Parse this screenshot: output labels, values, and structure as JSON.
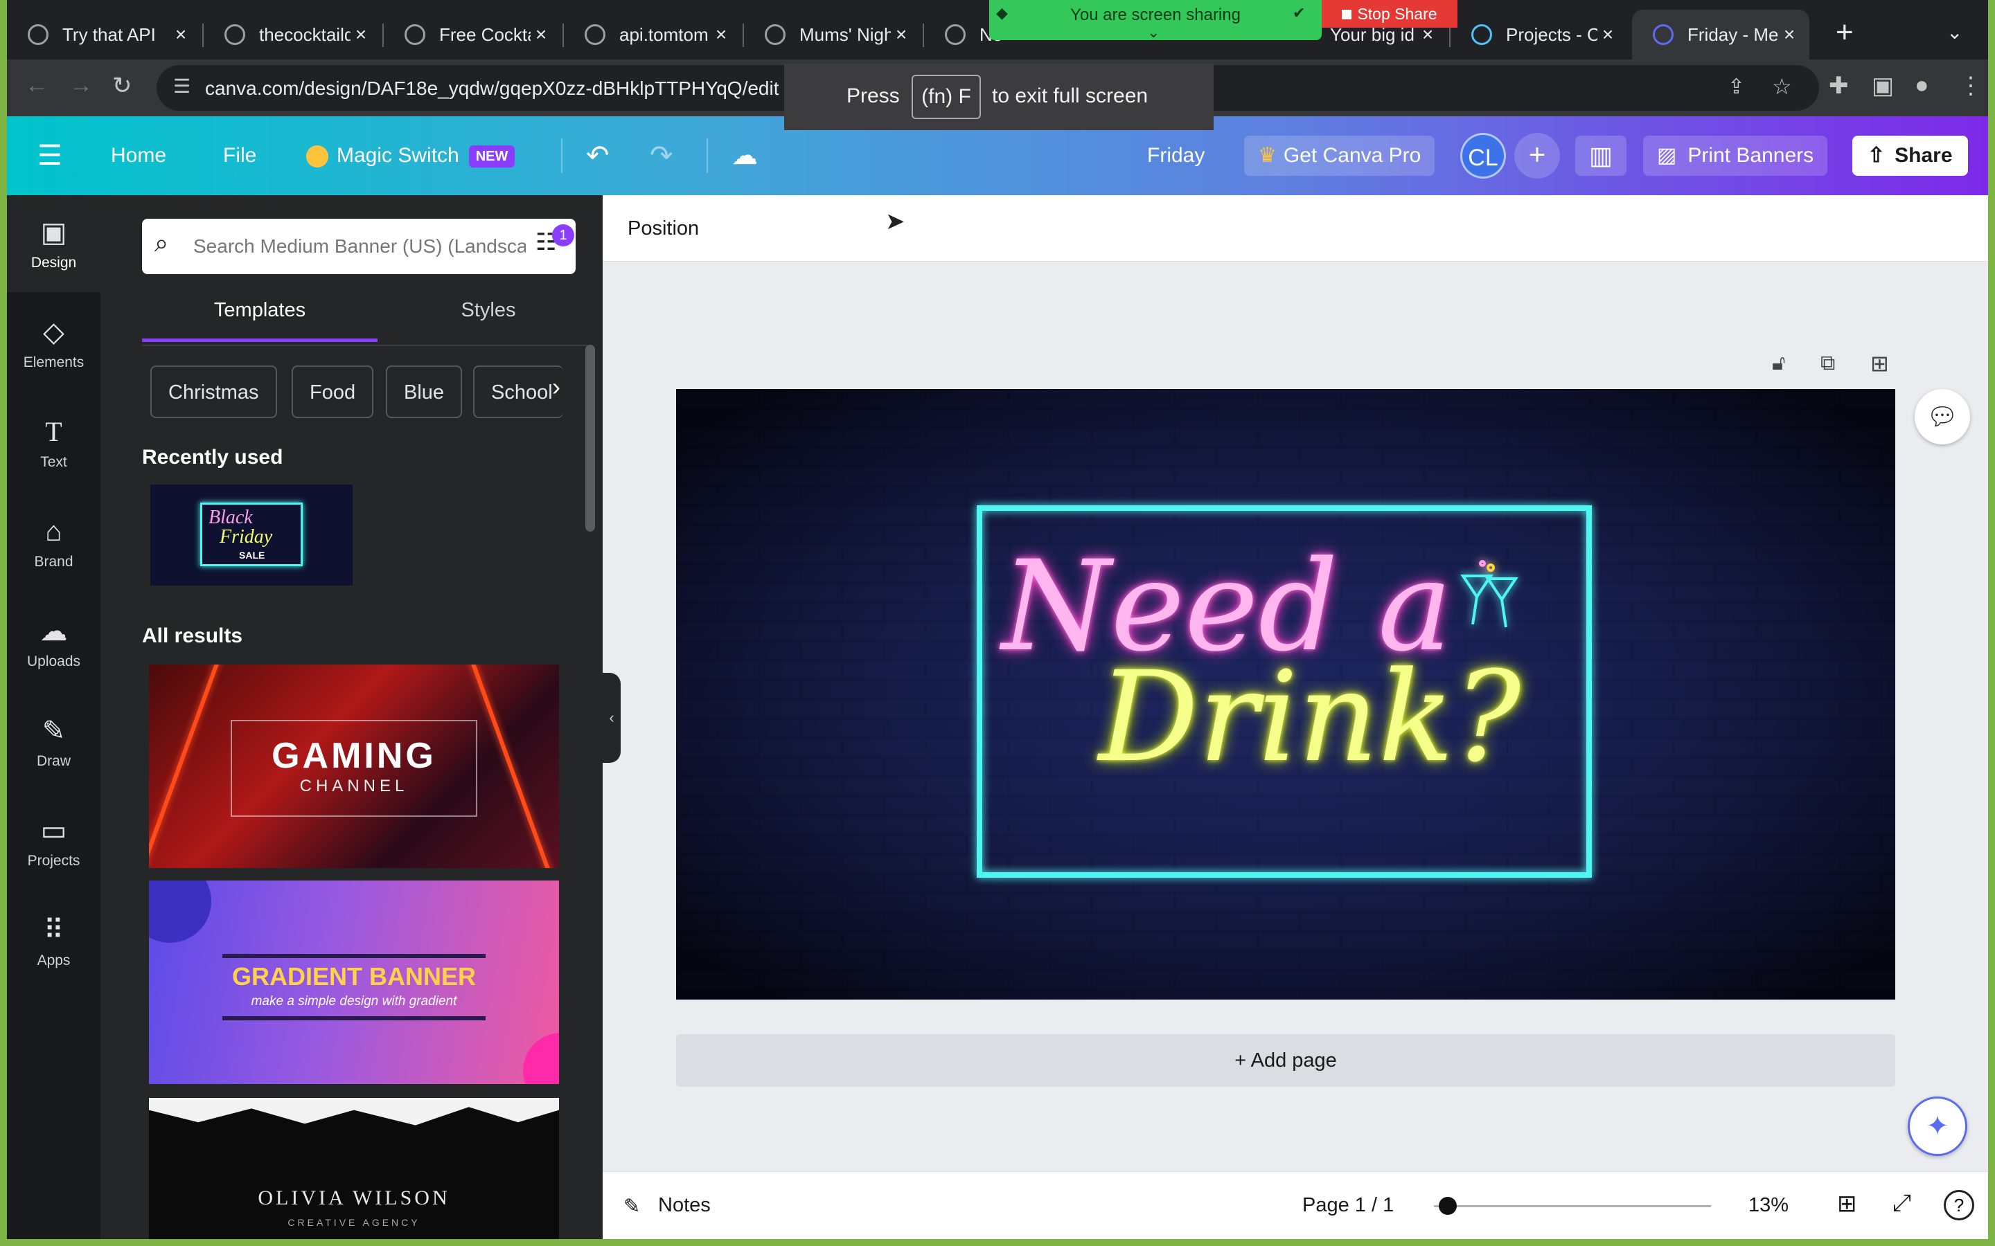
{
  "browser": {
    "tabs": [
      {
        "title": "Try that API"
      },
      {
        "title": "thecocktaildb"
      },
      {
        "title": "Free Cocktail"
      },
      {
        "title": "api.tomtom"
      },
      {
        "title": "Mums' Night"
      },
      {
        "title": "Ne"
      },
      {
        "title": "Your big id"
      },
      {
        "title": "Projects - C"
      },
      {
        "title": "Friday - Me"
      }
    ],
    "url": "canva.com/design/DAF18e_yqdw/gqepX0zz-dBHklpTTPHYqQ/edit",
    "screen_share_text": "You are screen sharing",
    "stop_share_label": "Stop Share",
    "fullscreen_press": "Press",
    "fullscreen_key": "(fn) F",
    "fullscreen_exit": "to exit full screen"
  },
  "header": {
    "home": "Home",
    "file": "File",
    "magic_switch": "Magic Switch",
    "new_badge": "NEW",
    "design_title": "Friday",
    "get_pro": "Get Canva Pro",
    "avatar_initials": "CL",
    "print_banners": "Print Banners",
    "share": "Share"
  },
  "rail": [
    {
      "label": "Design",
      "icon": "design-icon"
    },
    {
      "label": "Elements",
      "icon": "elements-icon"
    },
    {
      "label": "Text",
      "icon": "text-icon"
    },
    {
      "label": "Brand",
      "icon": "brand-icon"
    },
    {
      "label": "Uploads",
      "icon": "uploads-icon"
    },
    {
      "label": "Draw",
      "icon": "draw-icon"
    },
    {
      "label": "Projects",
      "icon": "projects-icon"
    },
    {
      "label": "Apps",
      "icon": "apps-icon"
    }
  ],
  "panel": {
    "search_placeholder": "Search Medium Banner (US) (Landscape)",
    "filter_badge": "1",
    "tabs": [
      "Templates",
      "Styles"
    ],
    "chips": [
      "Christmas",
      "Food",
      "Blue",
      "School"
    ],
    "recently_used": "Recently used",
    "recent_thumb": {
      "line1": "Black",
      "line2": "Friday",
      "line3": "SALE"
    },
    "all_results": "All results",
    "results": [
      {
        "title": "GAMING",
        "subtitle": "CHANNEL"
      },
      {
        "title": "GRADIENT BANNER",
        "subtitle": "make a simple design with gradient"
      },
      {
        "title": "OLIVIA WILSON",
        "subtitle": "CREATIVE AGENCY"
      }
    ]
  },
  "editor": {
    "context_label": "Position",
    "canvas_line1": "Need a",
    "canvas_line2": "Drink?",
    "add_page": "+ Add page",
    "notes": "Notes",
    "page_indicator": "Page 1 / 1",
    "zoom": "13%",
    "zoom_fraction": 0.05
  },
  "colors": {
    "neon_cyan": "#4ff5f0",
    "neon_pink": "#ff9ee8",
    "neon_yellow": "#f3ff6a",
    "accent_purple": "#8b3dff"
  }
}
